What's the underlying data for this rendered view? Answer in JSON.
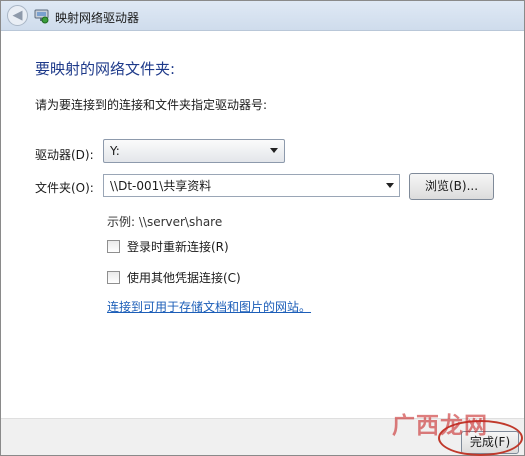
{
  "window": {
    "title": "映射网络驱动器"
  },
  "main": {
    "heading": "要映射的网络文件夹:",
    "instruction": "请为要连接到的连接和文件夹指定驱动器号:",
    "drive": {
      "label": "驱动器(D):",
      "value": "Y:"
    },
    "folder": {
      "label": "文件夹(O):",
      "value": "\\\\Dt-001\\共享资料"
    },
    "browse_button": "浏览(B)...",
    "example": "示例: \\\\server\\share",
    "reconnect_checkbox": {
      "label": "登录时重新连接(R)",
      "checked": false
    },
    "credentials_checkbox": {
      "label": "使用其他凭据连接(C)",
      "checked": false
    },
    "link": "连接到可用于存储文档和图片的网站。"
  },
  "footer": {
    "finish_button": "完成(F)"
  },
  "watermark": "广西龙网",
  "colors": {
    "heading": "#1e3a8a",
    "link": "#1c5eb8",
    "annotation": "#c0392b"
  },
  "icons": {
    "back": "back-arrow-icon",
    "title": "network-drive-icon"
  }
}
